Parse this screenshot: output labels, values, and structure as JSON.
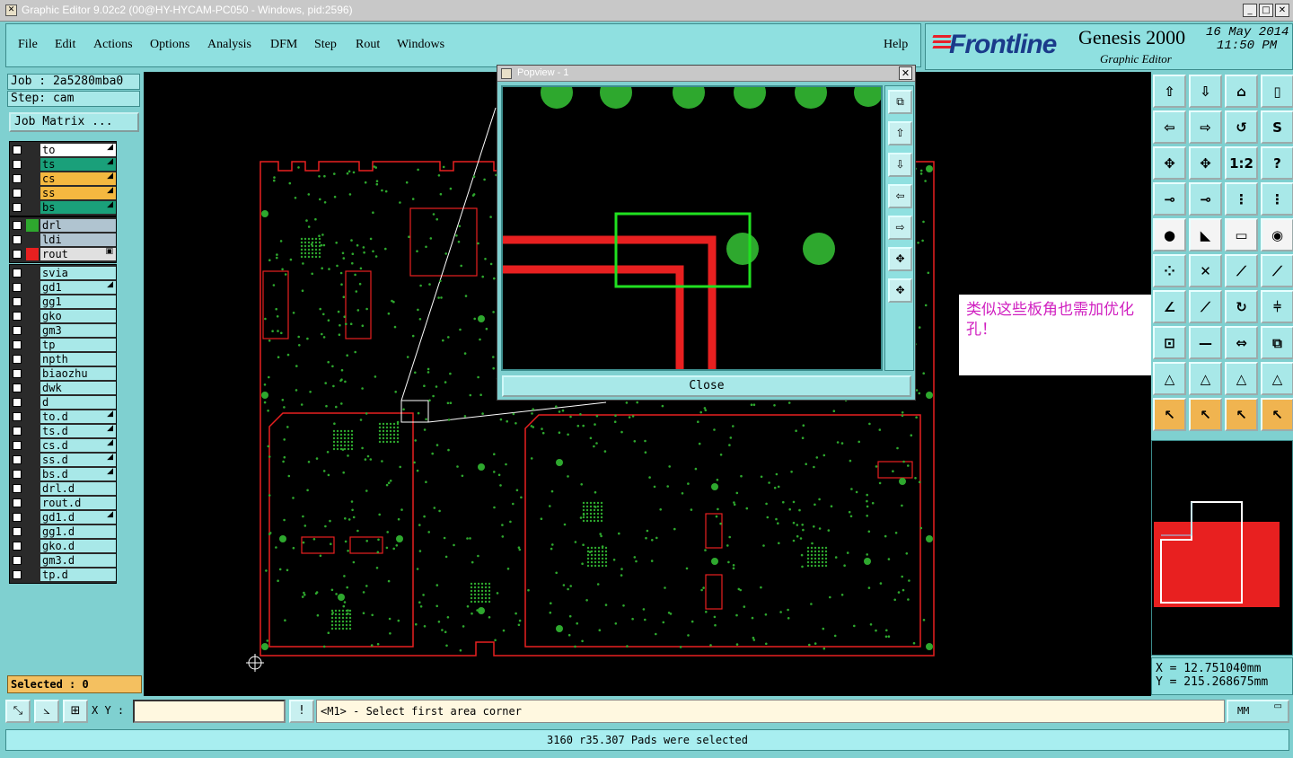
{
  "window": {
    "title": "Graphic Editor 9.02c2 (00@HY-HYCAM-PC050 - Windows, pid:2596)",
    "icon": "app-icon",
    "buttons": [
      "_",
      "□",
      "✕"
    ]
  },
  "menu": {
    "file": "File",
    "edit": "Edit",
    "actions": "Actions",
    "options": "Options",
    "analysis": "Analysis",
    "dfm": "DFM",
    "step": "Step",
    "rout": "Rout",
    "windows": "Windows",
    "help": "Help"
  },
  "brand": {
    "logo": "Frontline",
    "product": "Genesis 2000",
    "subtitle": "Graphic Editor",
    "date": "16 May 2014",
    "time": "11:50 PM"
  },
  "job": {
    "job_line": "Job : 2a5280mba0",
    "step_line": "Step: cam",
    "matrix_button": "Job Matrix ..."
  },
  "layers_group1": [
    {
      "name": "to",
      "color": "#ffffff",
      "arrow": "◢"
    },
    {
      "name": "ts",
      "color": "#1aa07a",
      "arrow": "◢"
    },
    {
      "name": "cs",
      "color": "#f4b840",
      "arrow": "◢"
    },
    {
      "name": "ss",
      "color": "#f4b840",
      "arrow": "◢"
    },
    {
      "name": "bs",
      "color": "#1aa07a",
      "arrow": "◢"
    }
  ],
  "layers_group2": [
    {
      "name": "drl",
      "color": "#b0c4d0",
      "swatch": "#2ea82e",
      "arrow": ""
    },
    {
      "name": "ldi",
      "color": "#b0c4d0",
      "swatch": "",
      "arrow": ""
    },
    {
      "name": "rout",
      "color": "#e0e0e0",
      "swatch": "#e82020",
      "arrow": "▣"
    }
  ],
  "layers_group3": [
    {
      "name": "svia",
      "color": "#a8e8e8",
      "arrow": ""
    },
    {
      "name": "gd1",
      "color": "#a8e8e8",
      "arrow": "◢"
    },
    {
      "name": "gg1",
      "color": "#a8e8e8",
      "arrow": ""
    },
    {
      "name": "gko",
      "color": "#a8e8e8",
      "arrow": ""
    },
    {
      "name": "gm3",
      "color": "#a8e8e8",
      "arrow": ""
    },
    {
      "name": "tp",
      "color": "#a8e8e8",
      "arrow": ""
    },
    {
      "name": "npth",
      "color": "#a8e8e8",
      "arrow": ""
    },
    {
      "name": "biaozhu",
      "color": "#a8e8e8",
      "arrow": ""
    },
    {
      "name": "dwk",
      "color": "#a8e8e8",
      "arrow": ""
    },
    {
      "name": "d",
      "color": "#a8e8e8",
      "arrow": ""
    },
    {
      "name": "to.d",
      "color": "#a8e8e8",
      "arrow": "◢"
    },
    {
      "name": "ts.d",
      "color": "#a8e8e8",
      "arrow": "◢"
    },
    {
      "name": "cs.d",
      "color": "#a8e8e8",
      "arrow": "◢"
    },
    {
      "name": "ss.d",
      "color": "#a8e8e8",
      "arrow": "◢"
    },
    {
      "name": "bs.d",
      "color": "#a8e8e8",
      "arrow": "◢"
    },
    {
      "name": "drl.d",
      "color": "#a8e8e8",
      "arrow": ""
    },
    {
      "name": "rout.d",
      "color": "#a8e8e8",
      "arrow": ""
    },
    {
      "name": "gd1.d",
      "color": "#a8e8e8",
      "arrow": "◢"
    },
    {
      "name": "gg1.d",
      "color": "#a8e8e8",
      "arrow": ""
    },
    {
      "name": "gko.d",
      "color": "#a8e8e8",
      "arrow": ""
    },
    {
      "name": "gm3.d",
      "color": "#a8e8e8",
      "arrow": ""
    },
    {
      "name": "tp.d",
      "color": "#a8e8e8",
      "arrow": ""
    }
  ],
  "selected": "Selected : 0",
  "popview": {
    "title": "Popview - 1",
    "close_label": "Close",
    "close_x": "✕"
  },
  "annotation": "类似这些板角也需加优化孔！",
  "toolbox": {
    "labels": [
      "⇧",
      "⇩",
      "⌂",
      "▯",
      "⇦",
      "⇨",
      "↺",
      "S",
      "✥",
      "✥",
      "1:2",
      "?",
      "⊸",
      "⊸",
      "⋮",
      "⋮",
      "●",
      "◣",
      "▭",
      "◉",
      "⁘",
      "✕",
      "⟋",
      "⟋",
      "∠",
      "⟋",
      "↻",
      "⫩",
      "⊡",
      "—",
      "⇔",
      "⧉",
      "△",
      "△",
      "△",
      "△",
      "↖",
      "↖",
      "↖",
      "↖"
    ]
  },
  "coords": {
    "x": "X = 12.751040mm",
    "y": "Y = 215.268675mm"
  },
  "bottom": {
    "xy_label": "X Y :",
    "xy_value": "",
    "bang": "!",
    "message": "<M1> - Select first area corner",
    "units": "MM",
    "status": "3160 r35.307 Pads were selected"
  },
  "colors": {
    "board_outline": "#e82020",
    "pads": "#2ea82e",
    "selection_box": "#20e020",
    "annotation_text": "#d020c0"
  }
}
